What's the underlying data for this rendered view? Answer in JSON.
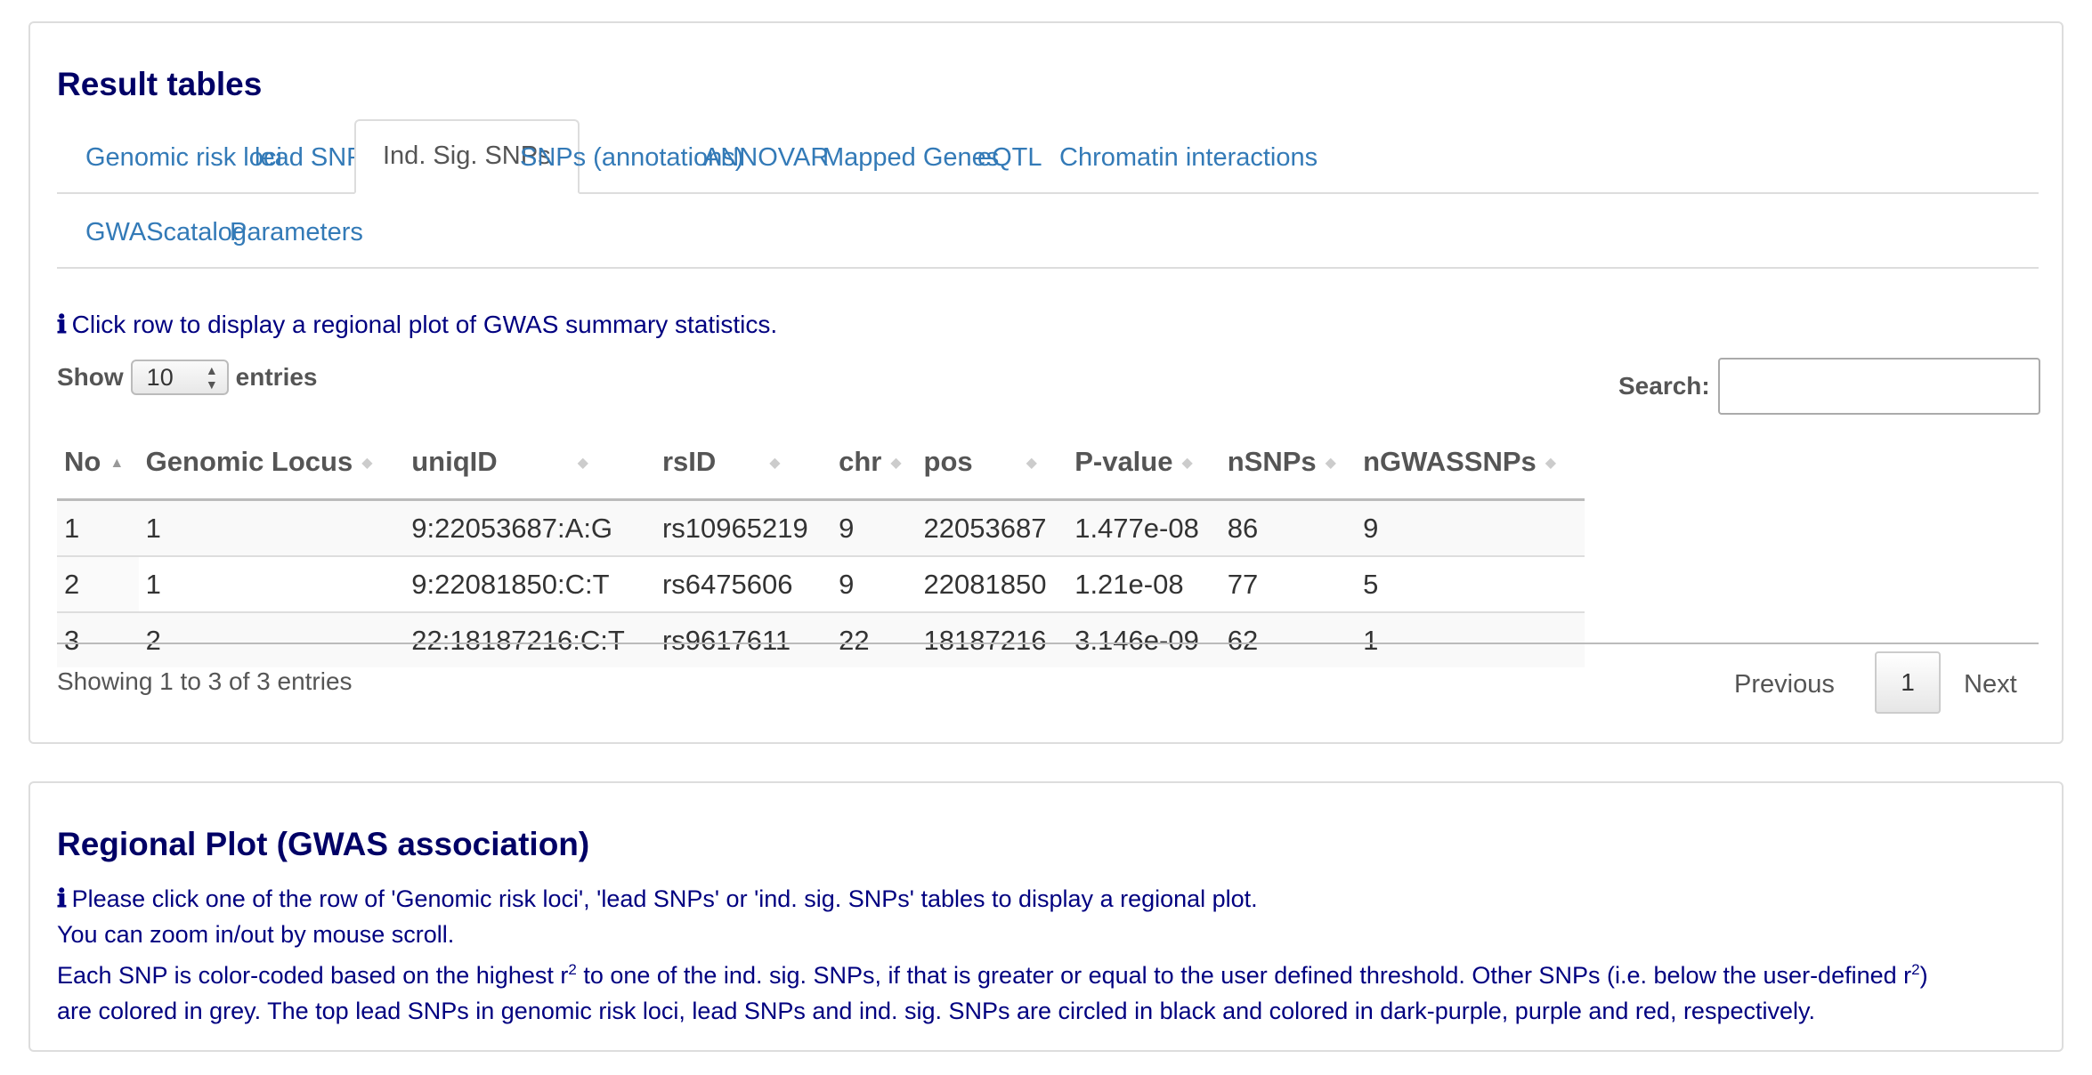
{
  "results_panel": {
    "title": "Result tables",
    "tabs": [
      {
        "label": "Genomic risk loci"
      },
      {
        "label": "lead SNPs"
      },
      {
        "label": "Ind. Sig. SNPs"
      },
      {
        "label": "SNPs (annotations)"
      },
      {
        "label": "ANNOVAR"
      },
      {
        "label": "Mapped Genes"
      },
      {
        "label": "eQTL"
      },
      {
        "label": "Chromatin interactions"
      },
      {
        "label": "GWAScatalog"
      },
      {
        "label": "Parameters"
      }
    ],
    "active_tab": "Ind. Sig. SNPs",
    "info_text": "Click row to display a regional plot of GWAS summary statistics.",
    "length_menu": {
      "prefix": "Show",
      "value": "10",
      "suffix": "entries"
    },
    "search": {
      "label": "Search:",
      "value": ""
    },
    "table": {
      "columns": [
        "No",
        "Genomic Locus",
        "uniqID",
        "rsID",
        "chr",
        "pos",
        "P-value",
        "nSNPs",
        "nGWASSNPs"
      ],
      "rows": [
        [
          "1",
          "1",
          "9:22053687:A:G",
          "rs10965219",
          "9",
          "22053687",
          "1.477e-08",
          "86",
          "9"
        ],
        [
          "2",
          "1",
          "9:22081850:C:T",
          "rs6475606",
          "9",
          "22081850",
          "1.21e-08",
          "77",
          "5"
        ],
        [
          "3",
          "2",
          "22:18187216:C:T",
          "rs9617611",
          "22",
          "18187216",
          "3.146e-09",
          "62",
          "1"
        ]
      ]
    },
    "info_footer": "Showing 1 to 3 of 3 entries",
    "pagination": {
      "previous": "Previous",
      "current_page": "1",
      "next": "Next"
    }
  },
  "regional_panel": {
    "title": "Regional Plot (GWAS association)",
    "line1": "Please click one of the row of 'Genomic risk loci', 'lead SNPs' or 'ind. sig. SNPs' tables to display a regional plot.",
    "line2": "You can zoom in/out by mouse scroll.",
    "line3_a": "Each SNP is color-coded based on the highest r",
    "line3_sup1": "2",
    "line3_b": " to one of the ind. sig. SNPs, if that is greater or equal to the user defined threshold. Other SNPs (i.e. below the user-defined r",
    "line3_sup2": "2",
    "line3_c": ")",
    "line4": "are colored in grey. The top lead SNPs in genomic risk loci, lead SNPs and ind. sig. SNPs are circled in black and colored in dark-purple, purple and red, respectively."
  },
  "colors": {
    "title": "#000066",
    "info_text": "#000080",
    "link": "#337ab7"
  }
}
